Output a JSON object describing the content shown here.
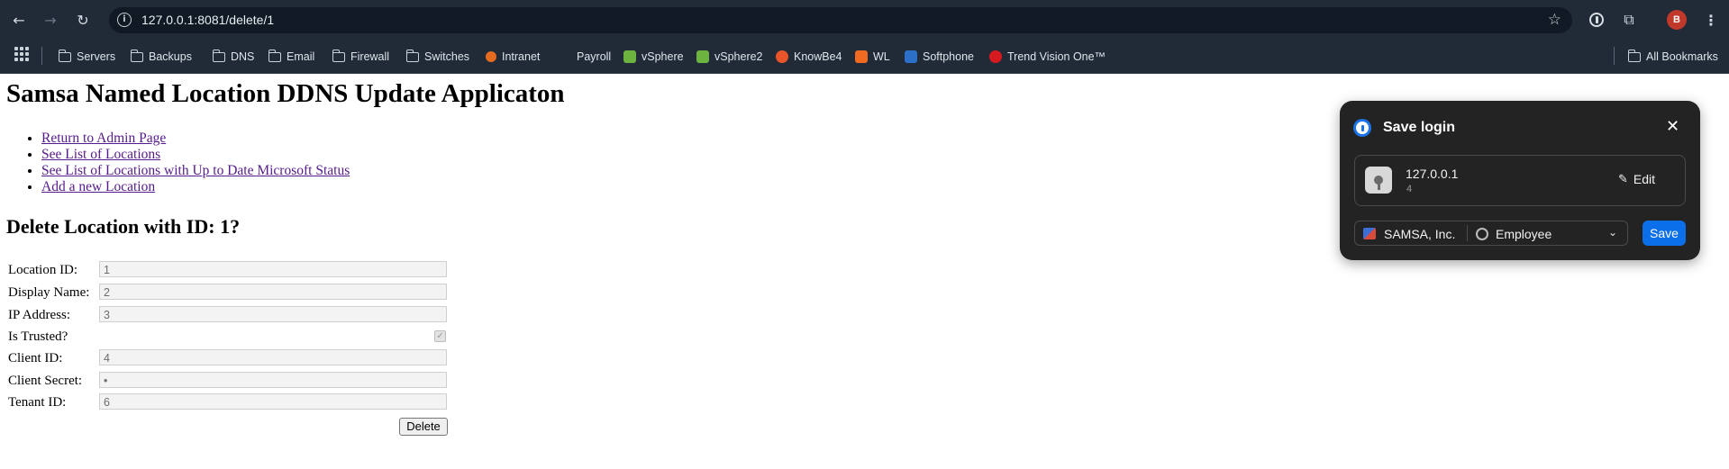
{
  "browser": {
    "url": "127.0.0.1:8081/delete/1",
    "profile_initial": "B",
    "bookmarks": [
      {
        "label": "Servers",
        "icon": "folder-icon"
      },
      {
        "label": "Backups",
        "icon": "folder-icon"
      },
      {
        "label": "DNS",
        "icon": "folder-icon"
      },
      {
        "label": "Email",
        "icon": "folder-icon"
      },
      {
        "label": "Firewall",
        "icon": "folder-icon"
      },
      {
        "label": "Switches",
        "icon": "folder-icon"
      },
      {
        "label": "Intranet",
        "icon": "intranet-favicon"
      },
      {
        "label": "Payroll",
        "icon": "payroll-favicon"
      },
      {
        "label": "vSphere",
        "icon": "vsphere-favicon"
      },
      {
        "label": "vSphere2",
        "icon": "vsphere-favicon"
      },
      {
        "label": "KnowBe4",
        "icon": "knowbe4-favicon"
      },
      {
        "label": "WL",
        "icon": "wl-favicon"
      },
      {
        "label": "Softphone",
        "icon": "softphone-favicon"
      },
      {
        "label": "Trend Vision One™",
        "icon": "trend-favicon"
      }
    ],
    "all_bookmarks": "All Bookmarks"
  },
  "page": {
    "title": "Samsa Named Location DDNS Update Applicaton",
    "nav_links": [
      "Return to Admin Page",
      "See List of Locations",
      "See List of Locations with Up to Date Microsoft Status",
      "Add a new Location"
    ],
    "heading": "Delete Location with ID: 1?",
    "form": {
      "location_id_label": "Location ID:",
      "location_id_value": "1",
      "display_name_label": "Display Name:",
      "display_name_value": "2",
      "ip_address_label": "IP Address:",
      "ip_address_value": "3",
      "is_trusted_label": "Is Trusted?",
      "is_trusted_checked": true,
      "client_id_label": "Client ID:",
      "client_id_value": "4",
      "client_secret_label": "Client Secret:",
      "client_secret_value": "•",
      "tenant_id_label": "Tenant ID:",
      "tenant_id_value": "6",
      "delete_label": "Delete"
    }
  },
  "popup": {
    "title": "Save login",
    "host": "127.0.0.1",
    "username": "4",
    "edit_label": "Edit",
    "account": "SAMSA, Inc.",
    "vault": "Employee",
    "save_label": "Save",
    "accent": "#0a6fe8"
  }
}
